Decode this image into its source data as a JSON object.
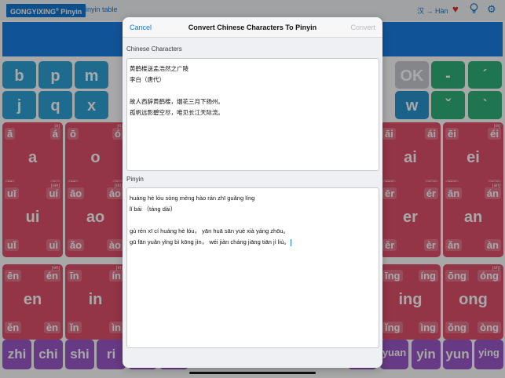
{
  "top_bar": {
    "app_title": "GONGYIXING",
    "app_title_mark": "®",
    "app_title_suffix": " Pinyin",
    "pinyin_table_link": "Pinyin table",
    "language_switch": "汉 → Hàn",
    "icons": [
      "heart-icon",
      "lightbulb-icon",
      "gear-icon"
    ],
    "colors": {
      "accent": "#1479d2",
      "heart": "#e52a2a"
    }
  },
  "keyboard": {
    "row1": [
      {
        "label": "b",
        "color": "blue"
      },
      {
        "label": "p",
        "color": "blue"
      },
      {
        "label": "m",
        "color": "blue"
      },
      {
        "label": "OK",
        "color": "gray"
      },
      {
        "label": "-",
        "color": "green"
      },
      {
        "label": "ˊ",
        "color": "green"
      }
    ],
    "row2": [
      {
        "label": "j",
        "color": "blue"
      },
      {
        "label": "q",
        "color": "blue"
      },
      {
        "label": "x",
        "color": "blue"
      },
      {
        "label": "w",
        "color": "blue"
      },
      {
        "label": "ˇ",
        "color": "green"
      },
      {
        "label": "ˋ",
        "color": "green"
      }
    ],
    "vowels_left": [
      {
        "main": "a",
        "ipa": "[a]",
        "tones": [
          "ā",
          "á",
          "ǎ",
          "à"
        ]
      },
      {
        "main": "o",
        "ipa": "[o]",
        "tones": [
          "ō",
          "ó",
          "ǒ",
          "ò"
        ]
      },
      {
        "main": "ui",
        "ipa": "[uei]",
        "tones": [
          "uī",
          "uí",
          "uǐ",
          "uì"
        ]
      },
      {
        "main": "ao",
        "ipa": "[ɑʊ]",
        "tones": [
          "āo",
          "áo",
          "ǎo",
          "ào"
        ]
      },
      {
        "main": "en",
        "ipa": "[ən]",
        "tones": [
          "ēn",
          "én",
          "ěn",
          "èn"
        ]
      },
      {
        "main": "in",
        "ipa": "[in]",
        "tones": [
          "īn",
          "ín",
          "ǐn",
          "ìn"
        ]
      }
    ],
    "vowels_right": [
      {
        "main": "ai",
        "ipa": "",
        "tones": [
          "āi",
          "ái",
          "ǎi",
          "ài"
        ]
      },
      {
        "main": "ei",
        "ipa": "[ei]",
        "tones": [
          "ēi",
          "éi",
          "ěi",
          "èi"
        ]
      },
      {
        "main": "er",
        "ipa": "",
        "tones": [
          "ēr",
          "ér",
          "ěr",
          "èr"
        ]
      },
      {
        "main": "an",
        "ipa": "[an]",
        "tones": [
          "ān",
          "án",
          "ǎn",
          "àn"
        ]
      },
      {
        "main": "ing",
        "ipa": "",
        "tones": [
          "īng",
          "íng",
          "ǐng",
          "ìng"
        ]
      },
      {
        "main": "ong",
        "ipa": "[ʊŋ]",
        "tones": [
          "ōng",
          "óng",
          "ǒng",
          "òng"
        ]
      }
    ],
    "bottom_row": [
      "zhi",
      "chi",
      "shi",
      "ri",
      "yuan",
      "yin",
      "yun",
      "ying"
    ]
  },
  "modal": {
    "cancel_label": "Cancel",
    "title": "Convert Chinese Characters To Pinyin",
    "convert_label": "Convert",
    "chinese_label": "Chinese Characters",
    "chinese_lines": [
      "黄鹤楼送孟浩然之广陵",
      "李白（唐代）",
      "",
      "故人西辞黄鹤楼，烟花三月下扬州。",
      "孤帆远影碧空尽，唯见长江天际流。"
    ],
    "pinyin_label": "Pinyin",
    "pinyin_lines": [
      "huáng hè lóu sòng mèng hào rán zhī guǎng líng",
      "lǐ bái （táng dài）",
      "",
      "gù rén xī cí huáng hè lóu，   yān huā sān yuè xià yáng zhōu。",
      "gū fān yuǎn yǐng bì kōng jìn，  wéi jiàn cháng jiāng tiān jì liú。"
    ]
  }
}
